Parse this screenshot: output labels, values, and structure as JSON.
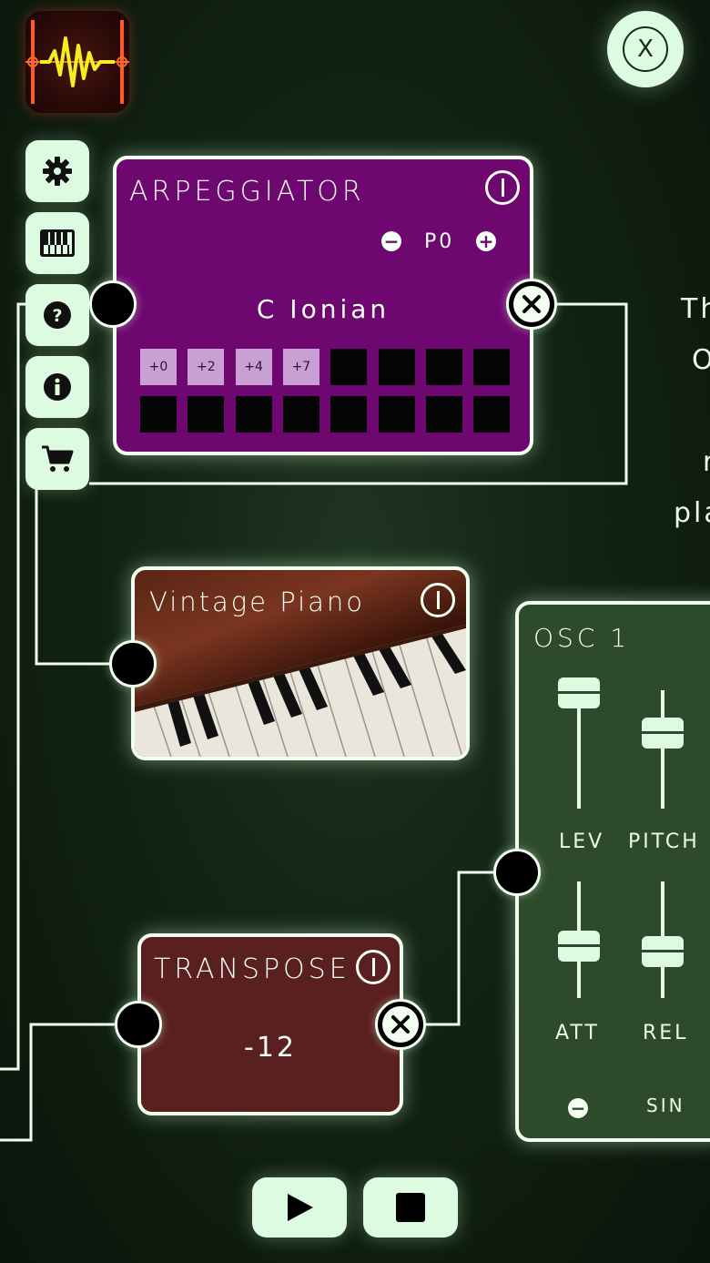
{
  "colors": {
    "background": "#122414",
    "button_bg": "#dcfbe0",
    "arpeggiator_bg": "#6e0770",
    "transpose_bg": "#5a1f1f",
    "osc_bg": "#2d4a2a",
    "active_cell": "#c8a0d4"
  },
  "app_icon": "waveform-app-icon",
  "close_label": "X",
  "sidebar": {
    "items": [
      {
        "name": "settings",
        "icon": "gear-icon"
      },
      {
        "name": "keyboard",
        "icon": "piano-keys-icon"
      },
      {
        "name": "help",
        "icon": "question-icon"
      },
      {
        "name": "info",
        "icon": "info-icon"
      },
      {
        "name": "store",
        "icon": "cart-icon"
      }
    ]
  },
  "arpeggiator": {
    "title": "ARPEGGIATOR",
    "preset_label": "P0",
    "minus": "−",
    "plus": "+",
    "scale": "C Ionian",
    "steps_row1": [
      "+0",
      "+2",
      "+4",
      "+7",
      "",
      "",
      "",
      ""
    ],
    "steps_row2": [
      "",
      "",
      "",
      "",
      "",
      "",
      "",
      ""
    ]
  },
  "piano": {
    "title": "Vintage Piano"
  },
  "transpose": {
    "title": "TRANSPOSE",
    "value": "-12"
  },
  "osc": {
    "title": "OSC 1",
    "faders": {
      "lev": {
        "label": "LEV",
        "level": 0.85
      },
      "pitch": {
        "label": "PITCH",
        "level": 0.6
      },
      "att": {
        "label": "ATT",
        "level": 0.55
      },
      "rel": {
        "label": "REL",
        "level": 0.55
      }
    },
    "minus": "−",
    "wave": "SIN"
  },
  "side_text": {
    "line1": "Th",
    "line2": "O",
    "line3": "r",
    "line4": "pla"
  },
  "transport": {
    "play_icon": "play-icon",
    "stop_icon": "stop-icon"
  }
}
